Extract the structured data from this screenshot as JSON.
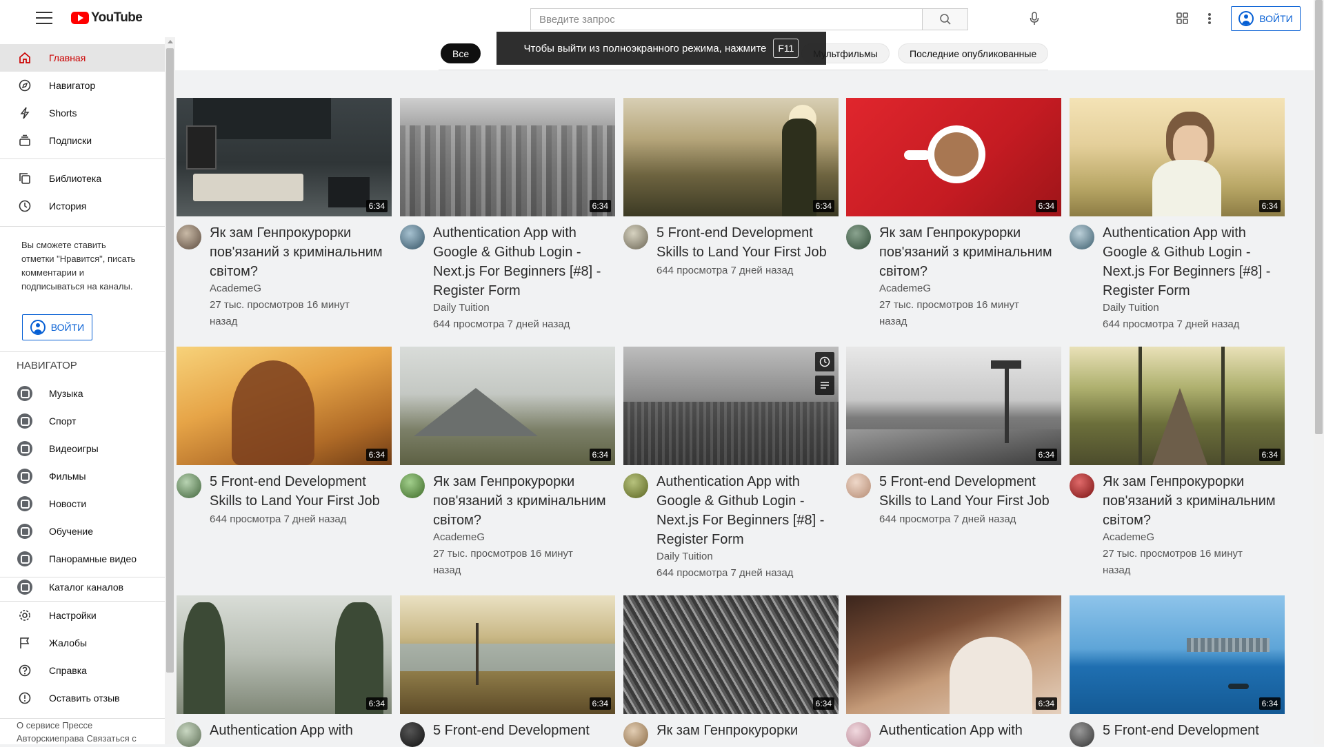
{
  "header": {
    "logo_text": "YouTube",
    "search_placeholder": "Введите запрос",
    "signin_label": "Войти"
  },
  "fullscreen_notice": {
    "text": "Чтобы выйти из полноэкранного режима, нажмите",
    "key": "F11"
  },
  "chips": [
    {
      "label": "Все",
      "active": true
    },
    {
      "label": "Мультфильмы",
      "active": false
    },
    {
      "label": "Последние опубликованные",
      "active": false
    }
  ],
  "sidebar": {
    "main": [
      {
        "label": "Главная",
        "icon": "home-icon",
        "active": true
      },
      {
        "label": "Навигатор",
        "icon": "compass-icon",
        "active": false
      },
      {
        "label": "Shorts",
        "icon": "shorts-icon",
        "active": false
      },
      {
        "label": "Подписки",
        "icon": "subscriptions-icon",
        "active": false
      }
    ],
    "library": [
      {
        "label": "Библиотека",
        "icon": "library-icon"
      },
      {
        "label": "История",
        "icon": "history-icon"
      }
    ],
    "promo_text": "Вы сможете ставить отметки \"Нравится\", писать комментарии и подписываться на каналы.",
    "signin_label": "Войти",
    "navigator_heading": "НАВИГАТОР",
    "navigator": [
      {
        "label": "Музыка"
      },
      {
        "label": "Спорт"
      },
      {
        "label": "Видеоигры"
      },
      {
        "label": "Фильмы"
      },
      {
        "label": "Новости"
      },
      {
        "label": "Обучение"
      },
      {
        "label": "Панорамные видео"
      }
    ],
    "catalog_label": "Каталог каналов",
    "settings": [
      {
        "label": "Настройки",
        "icon": "gear-icon"
      },
      {
        "label": "Жалобы",
        "icon": "flag-icon"
      },
      {
        "label": "Справка",
        "icon": "help-icon"
      },
      {
        "label": "Оставить отзыв",
        "icon": "feedback-icon"
      }
    ],
    "footer_text": "О сервисе Прессе Авторскиеправа Связаться с"
  },
  "videos": [
    {
      "title": "Як зам Генпрокурорки пов'язаний з кримінальним світом?",
      "channel": "AcademeG",
      "meta": "27 тыс. просмотров 16 минут назад",
      "duration": "6:34"
    },
    {
      "title": "Authentication App with Google & Github Login - Next.js For Beginners [#8] - Register Form",
      "channel": "Daily Tuition",
      "meta": "644 просмотра 7 дней назад",
      "duration": "6:34"
    },
    {
      "title": "5 Front-end Development Skills to Land Your First Job",
      "channel": "",
      "meta": "644 просмотра 7 дней назад",
      "duration": "6:34"
    },
    {
      "title": "Як зам Генпрокурорки пов'язаний з кримінальним світом?",
      "channel": "AcademeG",
      "meta": "27 тыс. просмотров 16 минут назад",
      "duration": "6:34"
    },
    {
      "title": "Authentication App with Google & Github Login - Next.js For Beginners [#8] - Register Form",
      "channel": "Daily Tuition",
      "meta": "644 просмотра 7 дней назад",
      "duration": "6:34"
    },
    {
      "title": "5 Front-end Development Skills to Land Your First Job",
      "channel": "",
      "meta": "644 просмотра 7 дней назад",
      "duration": "6:34"
    },
    {
      "title": "Як зам Генпрокурорки пов'язаний з кримінальним світом?",
      "channel": "AcademeG",
      "meta": "27 тыс. просмотров 16 минут назад",
      "duration": "6:34"
    },
    {
      "title": "Authentication App with Google & Github Login - Next.js For Beginners [#8] - Register Form",
      "channel": "Daily Tuition",
      "meta": "644 просмотра 7 дней назад",
      "duration": ""
    },
    {
      "title": "5 Front-end Development Skills to Land Your First Job",
      "channel": "",
      "meta": "644 просмотра 7 дней назад",
      "duration": "6:34"
    },
    {
      "title": "Як зам Генпрокурорки пов'язаний з кримінальним світом?",
      "channel": "AcademeG",
      "meta": "27 тыс. просмотров 16 минут назад",
      "duration": "6:34"
    },
    {
      "title": "Authentication App with",
      "channel": "",
      "meta": "",
      "duration": "6:34"
    },
    {
      "title": "5 Front-end Development",
      "channel": "",
      "meta": "",
      "duration": "6:34"
    },
    {
      "title": "Як зам Генпрокурорки",
      "channel": "",
      "meta": "",
      "duration": "6:34"
    },
    {
      "title": "Authentication App with",
      "channel": "",
      "meta": "",
      "duration": "6:34"
    },
    {
      "title": "5 Front-end Development",
      "channel": "",
      "meta": "",
      "duration": "6:34"
    }
  ]
}
